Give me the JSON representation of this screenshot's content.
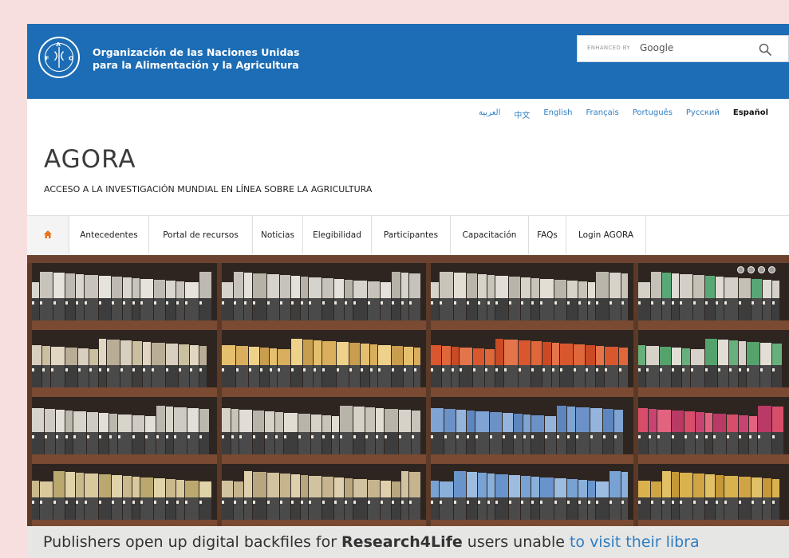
{
  "header": {
    "org_line1": "Organización de las Naciones Unidas",
    "org_line2": "para la Alimentación y la Agricultura",
    "logo_letters": "FAO"
  },
  "search": {
    "prefix": "ENHANCED BY",
    "brand": "Google",
    "icon": "search-icon"
  },
  "languages": [
    "العربية",
    "中文",
    "English",
    "Français",
    "Português",
    "Русский",
    "Español"
  ],
  "active_language": "Español",
  "site": {
    "title": "AGORA",
    "subtitle": "ACCESO A LA INVESTIGACIÓN MUNDIAL EN LÍNEA SOBRE LA AGRICULTURA"
  },
  "nav": {
    "home_icon": "home-icon",
    "items": [
      "Antecedentes",
      "Portal de recursos",
      "Noticias",
      "Elegibilidad",
      "Participantes",
      "Capacitación",
      "FAQs",
      "Login AGORA"
    ]
  },
  "hero": {
    "caption_start": "Publishers open up digital backfiles for ",
    "caption_bold": "Research4Life",
    "caption_mid": " users unable ",
    "caption_link": "to visit their libra",
    "dots": 4
  },
  "colors": {
    "header_blue": "#1c6db5",
    "accent_orange": "#e8731a",
    "link_blue": "#2f7ec1"
  }
}
